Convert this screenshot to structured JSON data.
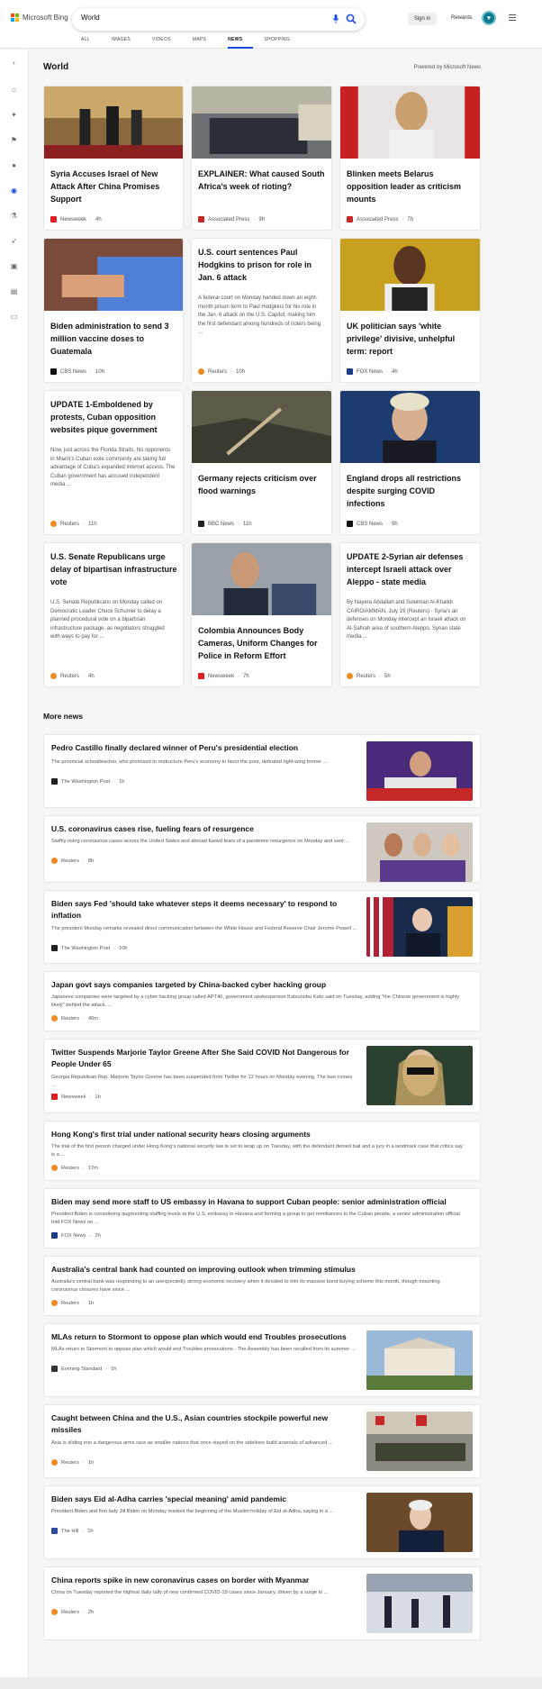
{
  "header": {
    "brand": "Microsoft Bing",
    "search_value": "World",
    "sign_in": "Sign in",
    "rewards": "Rewards",
    "tabs": [
      "ALL",
      "IMAGES",
      "VIDEOS",
      "MAPS",
      "NEWS",
      "SHOPPING"
    ],
    "active_tab": "NEWS"
  },
  "world": {
    "title": "World",
    "powered_by": "Powered by Microsoft News",
    "cards": [
      {
        "title": "Syria Accuses Israel of New Attack After China Promises Support",
        "snippet": "",
        "source": "Newsweek",
        "time": "4h",
        "logo_color": "#e02020"
      },
      {
        "title": "EXPLAINER: What caused South Africa's week of rioting?",
        "snippet": "",
        "source": "Associated Press",
        "time": "9h",
        "logo_color": "#c62828"
      },
      {
        "title": "Blinken meets Belarus opposition leader as criticism mounts",
        "snippet": "",
        "source": "Associated Press",
        "time": "7h",
        "logo_color": "#c62828"
      },
      {
        "title": "Biden administration to send 3 million vaccine doses to Guatemala",
        "snippet": "",
        "source": "CBS News",
        "time": "10h",
        "logo_color": "#111111"
      },
      {
        "title": "U.S. court sentences Paul Hodgkins to prison for role in Jan. 6 attack",
        "snippet": "A federal court on Monday handed down an eight-month prison term to Paul Hodgkins for his role in the Jan. 6 attack on the U.S. Capitol, making him the first defendant among hundreds of rioters being ...",
        "source": "Reuters",
        "time": "10h",
        "logo_color": "#f08a24"
      },
      {
        "title": "UK politician says 'white privilege' divisive, unhelpful term: report",
        "snippet": "",
        "source": "FOX News",
        "time": "4h",
        "logo_color": "#1a3a8a"
      },
      {
        "title": "UPDATE 1-Emboldened by protests, Cuban opposition websites pique government",
        "snippet": "Now, just across the Florida Straits, his opponents in Miami's Cuban exile community are taking full advantage of Cuba's expanded internet access. The Cuban government has accused independent media ...",
        "source": "Reuters",
        "time": "11h",
        "logo_color": "#f08a24"
      },
      {
        "title": "Germany rejects criticism over flood warnings",
        "snippet": "",
        "source": "BBC News",
        "time": "11h",
        "logo_color": "#222222"
      },
      {
        "title": "England drops all restrictions despite surging COVID infections",
        "snippet": "",
        "source": "CBS News",
        "time": "9h",
        "logo_color": "#111111"
      },
      {
        "title": "U.S. Senate Republicans urge delay of bipartisan infrastructure vote",
        "snippet": "U.S. Senate Republicans on Monday called on Democratic Leader Chuck Schumer to delay a planned procedural vote on a bipartisan infrastructure package, as negotiators struggled with ways to pay for ...",
        "source": "Reuters",
        "time": "4h",
        "logo_color": "#f08a24"
      },
      {
        "title": "Colombia Announces Body Cameras, Uniform Changes for Police in Reform Effort",
        "snippet": "",
        "source": "Newsweek",
        "time": "7h",
        "logo_color": "#e02020"
      },
      {
        "title": "UPDATE 2-Syrian air defenses intercept Israeli attack over Aleppo - state media",
        "snippet": "By Nayera Abdallah and Suleiman Al-Khalidi CAIRO/AMMAN, July 19 (Reuters) - Syria's air defenses on Monday intercept an Israeli attack on Al-Safirah area of southern Aleppo, Syrian state media ...",
        "source": "Reuters",
        "time": "5h",
        "logo_color": "#f08a24"
      }
    ]
  },
  "more_news": {
    "title": "More news",
    "items": [
      {
        "title": "Pedro Castillo finally declared winner of Peru's presidential election",
        "snippet": "The provincial schoolteacher, who promised to restructure Peru's economy to favor the poor, defeated right-wing former ...",
        "source": "The Washington Post",
        "time": "1h",
        "logo_color": "#222222"
      },
      {
        "title": "U.S. coronavirus cases rise, fueling fears of resurgence",
        "snippet": "Swiftly rising coronavirus cases across the United States and abroad fueled fears of a pandemic resurgence on Monday and sent ...",
        "source": "Reuters",
        "time": "8h",
        "logo_color": "#f08a24"
      },
      {
        "title": "Biden says Fed 'should take whatever steps it deems necessary' to respond to inflation",
        "snippet": "The president Monday remarks revealed direct communication between the White House and Federal Reserve Chair Jerome Powell ...",
        "source": "The Washington Post",
        "time": "10h",
        "logo_color": "#222222"
      },
      {
        "title": "Japan govt says companies targeted by China-backed cyber hacking group",
        "snippet": "Japanese companies were targeted by a cyber hacking group called APT40, government spokesperson Katsunobu Kato said on Tuesday, adding \"the Chinese government is highly likely\" behind the attack. ...",
        "source": "Reuters",
        "time": "46m",
        "logo_color": "#f08a24"
      },
      {
        "title": "Twitter Suspends Marjorie Taylor Greene After She Said COVID Not Dangerous for People Under 65",
        "snippet": "Georgia Republican Rep. Marjorie Taylor Greene has been suspended from Twitter for 12 hours on Monday evening. The ban comes ...",
        "source": "Newsweek",
        "time": "1h",
        "logo_color": "#e02020"
      },
      {
        "title": "Hong Kong's first trial under national security hears closing arguments",
        "snippet": "The trial of the first person charged under Hong Kong's national security law is set to wrap up on Tuesday, with the defendant denied bail and a jury in a landmark case that critics say is a ...",
        "source": "Reuters",
        "time": "17m",
        "logo_color": "#f08a24"
      },
      {
        "title": "Biden may send more staff to US embassy in Havana to support Cuban people: senior administration official",
        "snippet": "President Biden is considering augmenting staffing levels at the U.S. embassy in Havana and forming a group to get remittances to the Cuban people, a senior administration official told FOX News on ...",
        "source": "FOX News",
        "time": "2h",
        "logo_color": "#1a3a8a"
      },
      {
        "title": "Australia's central bank had counted on improving outlook when trimming stimulus",
        "snippet": "Australia's central bank was responding to an unexpectedly strong economic recovery when it decided to trim its massive bond buying scheme this month, though mounting coronavirus closures have since ...",
        "source": "Reuters",
        "time": "1h",
        "logo_color": "#f08a24"
      },
      {
        "title": "MLAs return to Stormont to oppose plan which would end Troubles prosecutions",
        "snippet": "MLAs return to Stormont to oppose plan which would end Troubles prosecutions - The Assembly has been recalled from its summer ...",
        "source": "Evening Standard",
        "time": "1h",
        "logo_color": "#333333"
      },
      {
        "title": "Caught between China and the U.S., Asian countries stockpile powerful new missiles",
        "snippet": "Asia is sliding into a dangerous arms race as smaller nations that once stayed on the sidelines build arsenals of advanced ...",
        "source": "Reuters",
        "time": "1h",
        "logo_color": "#f08a24"
      },
      {
        "title": "Biden says Eid al-Adha carries 'special meaning' amid pandemic",
        "snippet": "President Biden and first lady Jill Biden on Monday marked the beginning of the Muslim holiday of Eid al-Adha, saying in a ...",
        "source": "The Hill",
        "time": "1h",
        "logo_color": "#2b4aa0"
      },
      {
        "title": "China reports spike in new coronavirus cases on border with Myanmar",
        "snippet": "China on Tuesday reported the highest daily tally of new confirmed COVID-19 cases since January, driven by a surge in ...",
        "source": "Reuters",
        "time": "2h",
        "logo_color": "#f08a24"
      }
    ]
  }
}
